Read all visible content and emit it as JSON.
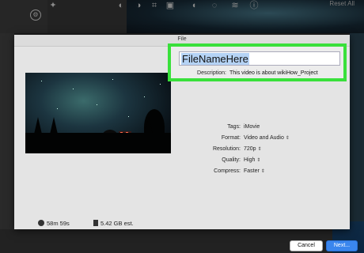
{
  "toolbar": {
    "reset_all": "Reset All",
    "icons": [
      "magic-wand-icon",
      "color-balance-icon",
      "color-correction-icon",
      "crop-icon",
      "stabilization-icon",
      "volume-icon",
      "speed-icon",
      "noise-reduction-icon",
      "info-icon"
    ]
  },
  "dialog": {
    "title": "File",
    "filename_value": "FileNameHere",
    "description_label": "Description:",
    "description_value": "This video is about wikiHow_Project",
    "fields": [
      {
        "label": "Tags:",
        "value": "iMovie"
      },
      {
        "label": "Format:",
        "value": "Video and Audio",
        "dropdown": true
      },
      {
        "label": "Resolution:",
        "value": "720p",
        "dropdown": true
      },
      {
        "label": "Quality:",
        "value": "High",
        "dropdown": true
      },
      {
        "label": "Compress:",
        "value": "Faster",
        "dropdown": true
      }
    ],
    "duration": "58m 59s",
    "file_size": "5.42 GB est.",
    "cancel_label": "Cancel",
    "next_label": "Next...",
    "highlight_color": "#39e03b",
    "accent_color": "#3a86ee"
  }
}
